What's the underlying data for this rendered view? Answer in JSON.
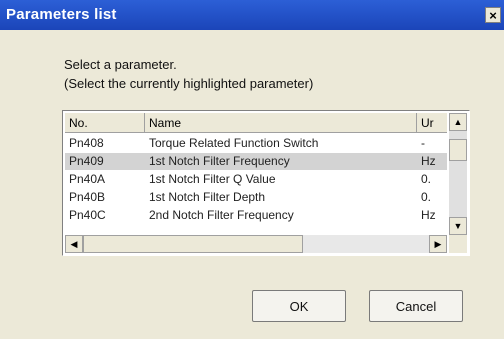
{
  "window": {
    "title": "Parameters list",
    "close_glyph": "×"
  },
  "instructions": {
    "line1": "Select a parameter.",
    "line2": "(Select the currently highlighted parameter)"
  },
  "table": {
    "columns": [
      "No.",
      "Name",
      "Ur"
    ],
    "rows": [
      {
        "no": "Pn408",
        "name": "Torque Related Function Switch",
        "unit": "-"
      },
      {
        "no": "Pn409",
        "name": "1st Notch Filter Frequency",
        "unit": "Hz"
      },
      {
        "no": "Pn40A",
        "name": "1st Notch Filter Q Value",
        "unit": "0."
      },
      {
        "no": "Pn40B",
        "name": "1st Notch Filter Depth",
        "unit": "0."
      },
      {
        "no": "Pn40C",
        "name": "2nd Notch Filter Frequency",
        "unit": "Hz"
      }
    ],
    "selected_index": 1
  },
  "scroll_glyphs": {
    "up": "▲",
    "down": "▼",
    "left": "◀",
    "right": "▶"
  },
  "buttons": {
    "ok": "OK",
    "cancel": "Cancel"
  },
  "colors": {
    "titlebar": "#1b45b9",
    "selection": "#d3d3d3",
    "dialog_bg": "#ece9d8"
  }
}
